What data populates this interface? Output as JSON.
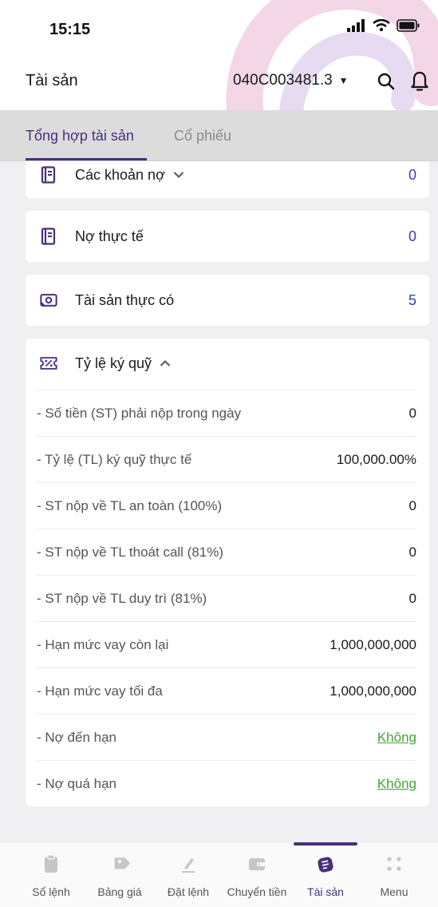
{
  "status_bar": {
    "time": "15:15"
  },
  "header": {
    "title": "Tài sản",
    "account": "040C003481.3",
    "icons": {
      "search": "search-icon",
      "bell": "bell-icon",
      "caret": "caret-down-icon"
    }
  },
  "tabs": [
    {
      "label": "Tổng hợp tài sản",
      "active": true
    },
    {
      "label": "Cổ phiếu",
      "active": false
    }
  ],
  "cards": {
    "debts": {
      "label": "Các khoản nợ",
      "value": "0"
    },
    "actual_debt": {
      "label": "Nợ thực tế",
      "value": "0"
    },
    "net_assets": {
      "label": "Tài sản thực có",
      "value": "5"
    },
    "margin": {
      "label": "Tỷ lệ ký quỹ",
      "rows": [
        {
          "label": "- Số tiền (ST) phải nộp trong ngày",
          "value": "0"
        },
        {
          "label": "- Tỷ lệ (TL) ký quỹ thực tế",
          "value": "100,000.00%"
        },
        {
          "label": "- ST nộp về TL an toàn (100%)",
          "value": "0"
        },
        {
          "label": "- ST nộp về TL thoát call (81%)",
          "value": "0"
        },
        {
          "label": "- ST nộp về TL duy trì (81%)",
          "value": "0"
        },
        {
          "label": "- Hạn mức vay còn lại",
          "value": "1,000,000,000"
        },
        {
          "label": "- Hạn mức vay tối đa",
          "value": "1,000,000,000"
        },
        {
          "label": "- Nợ đến hạn",
          "value": "Không"
        },
        {
          "label": "- Nợ quá hạn",
          "value": "Không"
        }
      ]
    }
  },
  "bottom_nav": [
    {
      "label": "Sổ lệnh",
      "icon": "clipboard-icon"
    },
    {
      "label": "Bảng giá",
      "icon": "price-tag-icon"
    },
    {
      "label": "Đặt lệnh",
      "icon": "order-pen-icon"
    },
    {
      "label": "Chuyển tiền",
      "icon": "wallet-transfer-icon"
    },
    {
      "label": "Tài sản",
      "icon": "assets-icon",
      "active": true
    },
    {
      "label": "Menu",
      "icon": "menu-dots-icon"
    }
  ],
  "colors": {
    "primary": "#4a2e7e",
    "value_blue": "#3b3fb6",
    "link_green": "#3fa83a",
    "tab_bg": "#dcdcdc",
    "page_bg": "#f0f0f2"
  }
}
